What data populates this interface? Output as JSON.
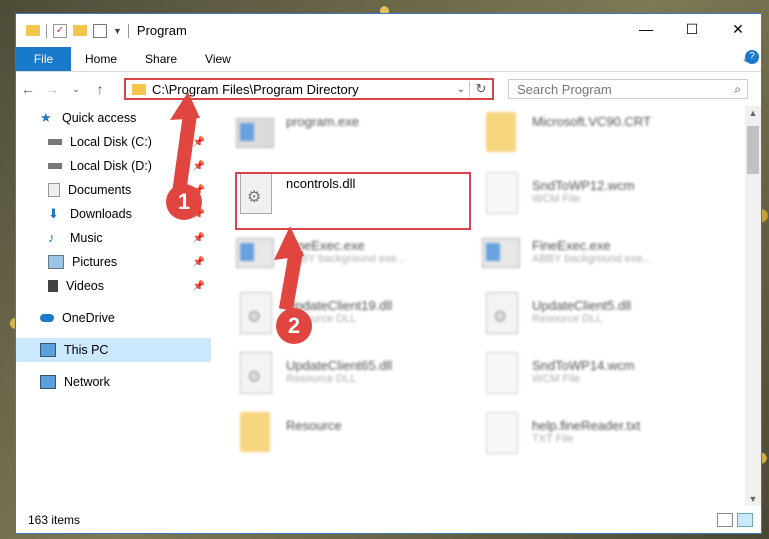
{
  "window": {
    "title": "Program"
  },
  "ribbon": {
    "file": "File",
    "home": "Home",
    "share": "Share",
    "view": "View"
  },
  "nav": {
    "address_path": "C:\\Program Files\\Program Directory",
    "search_placeholder": "Search Program"
  },
  "sidebar": {
    "items": [
      {
        "label": "Quick access"
      },
      {
        "label": "Local Disk (C:)"
      },
      {
        "label": "Local Disk (D:)"
      },
      {
        "label": "Documents"
      },
      {
        "label": "Downloads"
      },
      {
        "label": "Music"
      },
      {
        "label": "Pictures"
      },
      {
        "label": "Videos"
      },
      {
        "label": "OneDrive"
      },
      {
        "label": "This PC"
      },
      {
        "label": "Network"
      }
    ]
  },
  "files": [
    {
      "name": "program.exe",
      "sub": ""
    },
    {
      "name": "Microsoft.VC90.CRT",
      "sub": ""
    },
    {
      "name": "ncontrols.dll",
      "sub": ""
    },
    {
      "name": "SndToWP12.wcm",
      "sub": "WCM File"
    },
    {
      "name": "FineExec.exe",
      "sub": "ABBY background exe..."
    },
    {
      "name": "FineExec.exe",
      "sub": "ABBY background exe..."
    },
    {
      "name": "UpdateClient19.dll",
      "sub": "Resource DLL"
    },
    {
      "name": "UpdateClient5.dll",
      "sub": "Resource DLL"
    },
    {
      "name": "UpdateClient65.dll",
      "sub": "Resource DLL"
    },
    {
      "name": "SndToWP14.wcm",
      "sub": "WCM File"
    },
    {
      "name": "Resource",
      "sub": ""
    },
    {
      "name": "help.fineReader.txt",
      "sub": "TXT File"
    }
  ],
  "status": {
    "items": "163 items"
  },
  "callouts": {
    "one": "1",
    "two": "2"
  },
  "colors": {
    "accent": "#1979ca",
    "highlight": "#d9444a",
    "selected": "#cce8ff"
  }
}
